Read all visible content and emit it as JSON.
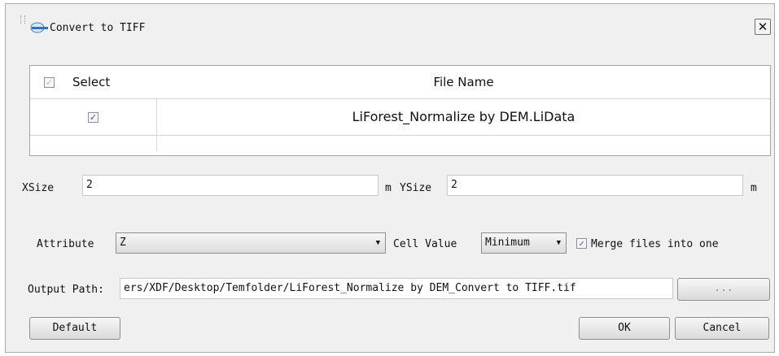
{
  "window": {
    "title": "Convert to TIFF",
    "close_glyph": "✕"
  },
  "table": {
    "columns": [
      "Select",
      "File Name"
    ],
    "rows": [
      {
        "checked": true,
        "file_name": "LiForest_Normalize by DEM.LiData"
      }
    ]
  },
  "size": {
    "xsize_label": "XSize",
    "xsize_value": "2",
    "xsize_unit": "m",
    "ysize_label": "YSize",
    "ysize_value": "2",
    "ysize_unit": "m"
  },
  "options": {
    "attribute_label": "Attribute",
    "attribute_value": "Z",
    "cell_value_label": "Cell Value",
    "cell_value_selected": "Minimum",
    "merge_label": "Merge files into one",
    "merge_checked": true
  },
  "output": {
    "label": "Output Path:",
    "value": "ers/XDF/Desktop/Temfolder/LiForest_Normalize by DEM_Convert to TIFF.tif",
    "browse_label": "..."
  },
  "buttons": {
    "default": "Default",
    "ok": "OK",
    "cancel": "Cancel"
  },
  "icons": {
    "check": "✓",
    "dropdown": "▼"
  },
  "colors": {
    "dialog_bg": "#f0f0f0",
    "check_mark": "#3a5ba8"
  }
}
